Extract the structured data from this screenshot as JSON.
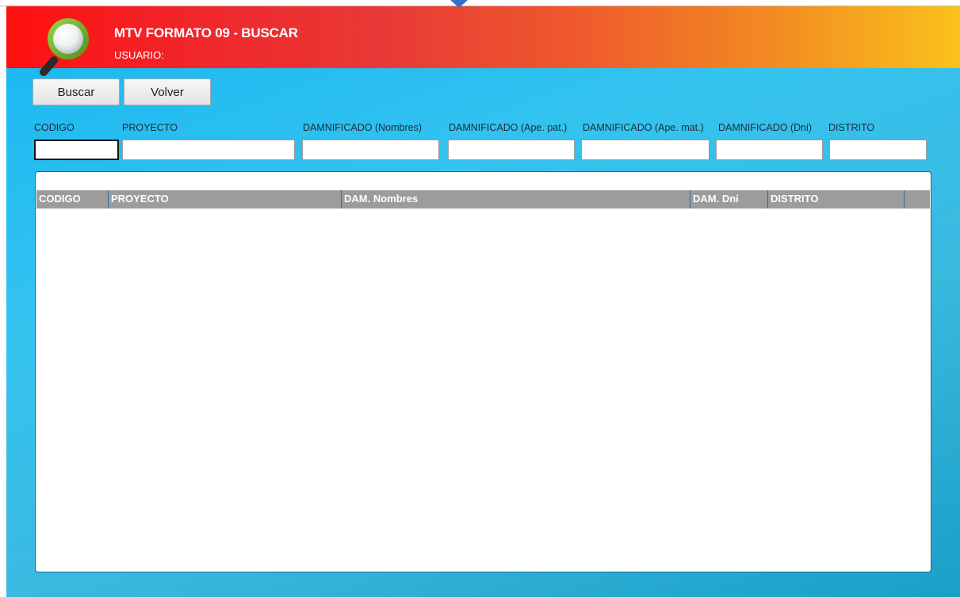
{
  "header": {
    "title": "MTV FORMATO 09 - BUSCAR",
    "user_label": "USUARIO:",
    "logo_icon": "search-magnifier-icon"
  },
  "toolbar": {
    "buscar_label": "Buscar",
    "volver_label": "Volver"
  },
  "filters": [
    {
      "label": "CODIGO",
      "value": ""
    },
    {
      "label": "PROYECTO",
      "value": ""
    },
    {
      "label": "DAMNIFICADO (Nombres)",
      "value": ""
    },
    {
      "label": "DAMNIFICADO (Ape. pat.)",
      "value": ""
    },
    {
      "label": "DAMNIFICADO (Ape. mat.)",
      "value": ""
    },
    {
      "label": "DAMNIFICADO (Dni)",
      "value": ""
    },
    {
      "label": "DISTRITO",
      "value": ""
    }
  ],
  "grid": {
    "columns": [
      "CODIGO",
      "PROYECTO",
      "DAM. Nombres",
      "DAM. Dni",
      "DISTRITO"
    ],
    "rows": []
  },
  "colors": {
    "header_start": "#ff1010",
    "header_end": "#fbc21b",
    "background": "#2fbdec",
    "grid_header": "#9c9c9c"
  }
}
